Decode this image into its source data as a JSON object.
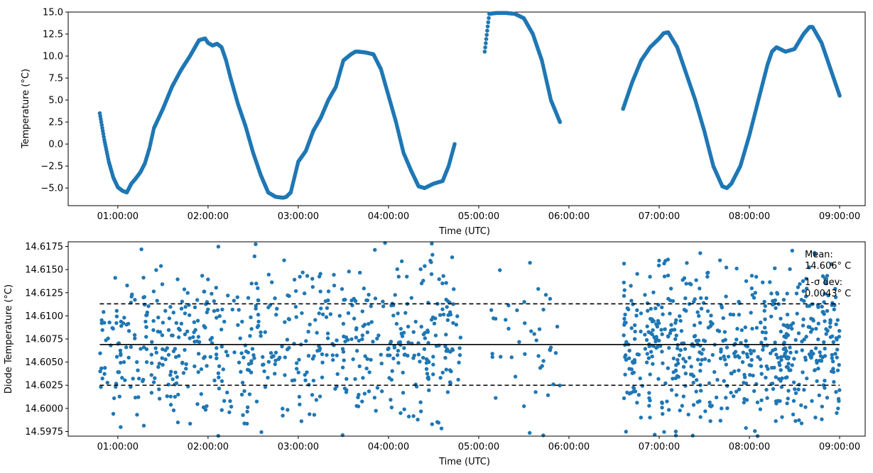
{
  "chart_data": [
    {
      "type": "scatter",
      "title": "",
      "xlabel": "Time (UTC)",
      "ylabel": "Temperature (°C)",
      "xlim": [
        "00:27:00",
        "09:17:00"
      ],
      "ylim": [
        -7.0,
        15.0
      ],
      "xticks": [
        "01:00:00",
        "02:00:00",
        "03:00:00",
        "04:00:00",
        "05:00:00",
        "06:00:00",
        "07:00:00",
        "08:00:00",
        "09:00:00"
      ],
      "yticks": [
        "−5.0",
        "−2.5",
        "0.0",
        "2.5",
        "5.0",
        "7.5",
        "10.0",
        "12.5",
        "15.0"
      ],
      "grid": false,
      "marker_color": "#1f77b4",
      "series": [
        {
          "x": [
            "00:48:00",
            "00:51:00",
            "00:54:00",
            "00:57:00",
            "01:00:00",
            "01:03:00",
            "01:06:00",
            "01:09:00",
            "01:12:00",
            "01:15:00",
            "01:18:00",
            "01:21:00",
            "01:24:00",
            "01:30:00",
            "01:36:00",
            "01:42:00",
            "01:48:00",
            "01:54:00",
            "01:58:00",
            "02:00:00",
            "02:03:00",
            "02:06:00",
            "02:09:00",
            "02:12:00",
            "02:15:00",
            "02:20:00",
            "02:25:00",
            "02:30:00",
            "02:35:00",
            "02:40:00",
            "02:45:00",
            "02:50:00",
            "02:52:00",
            "02:55:00",
            "03:00:00",
            "03:05:00",
            "03:10:00",
            "03:15:00",
            "03:20:00",
            "03:25:00",
            "03:30:00",
            "03:35:00",
            "03:38:00",
            "03:40:00",
            "03:45:00",
            "03:50:00",
            "03:55:00",
            "04:00:00",
            "04:05:00",
            "04:10:00",
            "04:15:00",
            "04:20:00",
            "04:24:00",
            "04:30:00",
            "04:36:00",
            "04:40:00",
            "04:44:00",
            "05:04:00",
            "05:07:00",
            "05:12:00",
            "05:18:00",
            "05:24:00",
            "05:30:00",
            "05:36:00",
            "05:42:00",
            "05:48:00",
            "05:54:00",
            "06:36:00",
            "06:42:00",
            "06:48:00",
            "06:54:00",
            "07:00:00",
            "07:03:00",
            "07:06:00",
            "07:12:00",
            "07:18:00",
            "07:24:00",
            "07:30:00",
            "07:36:00",
            "07:42:00",
            "07:45:00",
            "07:48:00",
            "07:54:00",
            "08:00:00",
            "08:06:00",
            "08:12:00",
            "08:15:00",
            "08:18:00",
            "08:24:00",
            "08:30:00",
            "08:36:00",
            "08:40:00",
            "08:42:00",
            "08:48:00",
            "08:54:00",
            "09:00:00"
          ],
          "y": [
            3.5,
            0.5,
            -2.0,
            -3.8,
            -4.9,
            -5.3,
            -5.5,
            -4.5,
            -3.9,
            -3.2,
            -2.2,
            -0.5,
            1.8,
            4.0,
            6.5,
            8.4,
            10.0,
            11.8,
            12.0,
            11.5,
            11.2,
            11.4,
            11.0,
            9.5,
            7.5,
            4.5,
            2.0,
            -1.0,
            -3.5,
            -5.5,
            -6.0,
            -6.1,
            -6.0,
            -5.5,
            -2.0,
            -0.8,
            1.5,
            3.0,
            5.0,
            6.5,
            9.5,
            10.2,
            10.5,
            10.5,
            10.4,
            10.2,
            8.5,
            5.5,
            2.5,
            -1.0,
            -3.0,
            -4.8,
            -5.0,
            -4.5,
            -4.2,
            -2.5,
            0.0,
            10.5,
            14.8,
            14.9,
            14.9,
            14.8,
            14.3,
            12.5,
            9.5,
            5.0,
            2.5,
            4.0,
            7.0,
            9.5,
            11.0,
            12.0,
            12.6,
            12.7,
            11.0,
            8.0,
            5.0,
            1.5,
            -2.5,
            -4.8,
            -5.0,
            -4.5,
            -2.5,
            1.0,
            5.0,
            9.0,
            10.5,
            11.0,
            10.5,
            10.8,
            12.5,
            13.3,
            13.3,
            11.5,
            8.5,
            5.5
          ]
        }
      ]
    },
    {
      "type": "scatter",
      "title": "",
      "xlabel": "Time (UTC)",
      "ylabel": "Diode Temperature (°C)",
      "xlim": [
        "00:27:00",
        "09:17:00"
      ],
      "ylim": [
        14.597,
        14.618
      ],
      "xticks": [
        "01:00:00",
        "02:00:00",
        "03:00:00",
        "04:00:00",
        "05:00:00",
        "06:00:00",
        "07:00:00",
        "08:00:00",
        "09:00:00"
      ],
      "yticks": [
        "14.5975",
        "14.6000",
        "14.6025",
        "14.6050",
        "14.6075",
        "14.6100",
        "14.6125",
        "14.6150",
        "14.6175"
      ],
      "grid": false,
      "marker_color": "#1f77b4",
      "mean": 14.6069,
      "band": [
        14.6025,
        14.6113
      ],
      "line_span": [
        "00:48:00",
        "09:00:00"
      ],
      "segments": [
        {
          "start": "00:48:00",
          "end": "04:48:00",
          "count": 640
        },
        {
          "start": "05:06:00",
          "end": "05:54:00",
          "count": 45
        },
        {
          "start": "06:36:00",
          "end": "09:00:00",
          "count": 620
        }
      ],
      "annotation_mean_label": "Mean:",
      "annotation_mean_value": "14.606° C",
      "annotation_sd_label": "1-σ dev:",
      "annotation_sd_value": "0.0043° C"
    }
  ]
}
